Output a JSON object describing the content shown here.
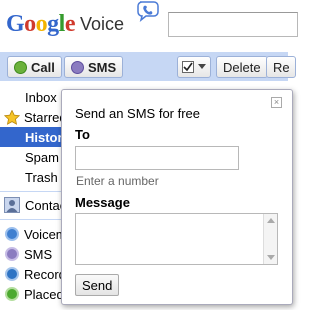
{
  "header": {
    "logo_google_letters": [
      "G",
      "o",
      "o",
      "g",
      "l",
      "e"
    ],
    "logo_google_colors": [
      "#3366cc",
      "#d03a2c",
      "#f3b300",
      "#3366cc",
      "#359b2d",
      "#d03a2c"
    ],
    "logo_product": "Voice",
    "search_value": ""
  },
  "toolbar": {
    "call_label": "Call",
    "sms_label": "SMS",
    "delete_label": "Delete",
    "next_label": "Re"
  },
  "sidebar": {
    "items": [
      {
        "label": "Inbox",
        "icon": "none"
      },
      {
        "label": "Starred",
        "icon": "star-icon"
      },
      {
        "label": "History",
        "icon": "none",
        "active": true
      },
      {
        "label": "Spam",
        "icon": "none"
      },
      {
        "label": "Trash",
        "icon": "none"
      }
    ],
    "contacts_label": "Contacts",
    "secondary": [
      {
        "label": "Voicemail",
        "icon": "voicemail-icon",
        "color": "#3f7fd0"
      },
      {
        "label": "SMS",
        "icon": "sms-icon",
        "color": "#8b7cc0"
      },
      {
        "label": "Recorded",
        "icon": "recorded-icon",
        "color": "#2f74c4"
      },
      {
        "label": "Placed",
        "icon": "placed-icon",
        "color": "#4caa2f"
      }
    ]
  },
  "popup": {
    "title": "Send an SMS for free",
    "close_glyph": "×",
    "to_label": "To",
    "to_value": "",
    "to_hint": "Enter a number",
    "message_label": "Message",
    "message_value": "",
    "send_label": "Send"
  },
  "colors": {
    "toolbar_bg": "#c6d7f4",
    "active_nav_bg": "#3366cc"
  }
}
